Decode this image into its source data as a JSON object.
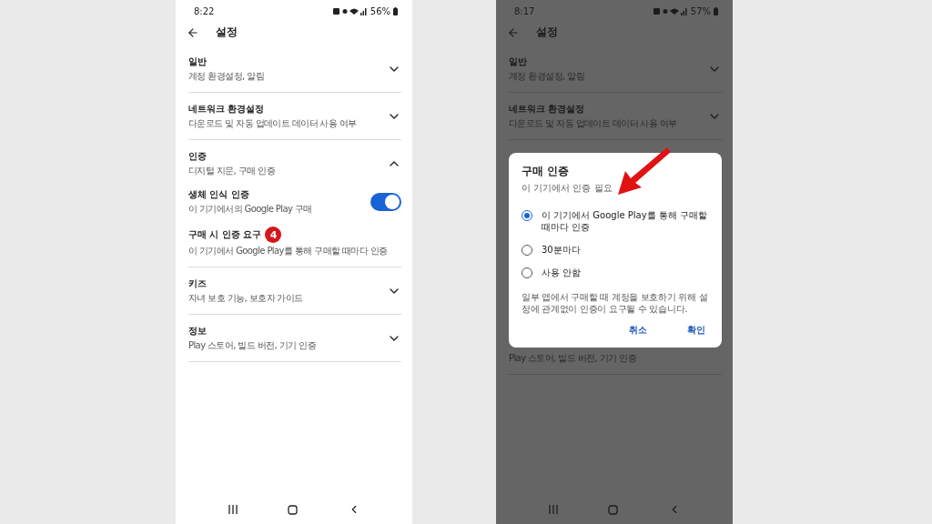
{
  "screens": [
    {
      "dimmed": false,
      "status": {
        "time": "8:22",
        "battery": "56%"
      },
      "title": "설정",
      "sections": [
        {
          "title": "일반",
          "subtitle": "계정 환경설정, 알림",
          "expanded": false
        },
        {
          "title": "네트워크 환경설정",
          "subtitle": "다운로드 및 자동 업데이트 데이터 사용 여부",
          "expanded": false
        },
        {
          "title": "인증",
          "subtitle": "디지털 지문, 구매 인증",
          "expanded": true,
          "children": [
            {
              "kind": "toggle",
              "title": "생체 인식 인증",
              "subtitle": "이 기기에서의 Google Play 구매",
              "on": true
            },
            {
              "kind": "plain",
              "title": "구매 시 인증 요구",
              "subtitle": "이 기기에서 Google Play를 통해 구매할 때마다 인증",
              "badge": "4"
            }
          ]
        },
        {
          "title": "키즈",
          "subtitle": "자녀 보호 기능, 보호자 가이드",
          "expanded": false
        },
        {
          "title": "정보",
          "subtitle": "Play 스토어, 빌드 버전, 기기 인증",
          "expanded": false
        }
      ]
    },
    {
      "dimmed": true,
      "status": {
        "time": "8:17",
        "battery": "57%"
      },
      "title": "설정",
      "sections": [
        {
          "title": "일반",
          "subtitle": "계정 환경설정, 알림",
          "expanded": false
        },
        {
          "title": "네트워크 환경설정",
          "subtitle": "다운로드 및 자동 업데이트 데이터 사용 여부",
          "expanded": false
        }
      ],
      "dialog": {
        "title": "구매 인증",
        "subtitle": "이 기기에서 인증 필요",
        "options": [
          {
            "label": "이 기기에서 Google Play를 통해 구매할 때마다 인증",
            "selected": true
          },
          {
            "label": "30분마다",
            "selected": false
          },
          {
            "label": "사용 안함",
            "selected": false
          }
        ],
        "note": "일부 앱에서 구매할 때 계정을 보호하기 위해 설정에 관계없이 인증이 요구될 수 있습니다.",
        "buttons": [
          "취소",
          "확인"
        ]
      },
      "below_dialog": [
        {
          "subtitle": "Play 스토어, 빌드 버전, 기기 인증"
        }
      ]
    }
  ]
}
